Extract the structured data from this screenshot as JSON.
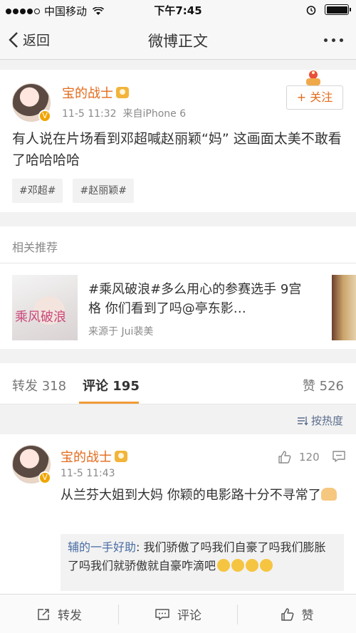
{
  "status_bar": {
    "carrier": "中国移动",
    "time": "下午7:45"
  },
  "nav": {
    "back_label": "返回",
    "title": "微博正文"
  },
  "post": {
    "username": "宝的战士",
    "date": "11-5 11:32",
    "source": "来自iPhone 6",
    "follow_label": "+ 关注",
    "text": "有人说在片场看到邓超喊赵丽颖“妈” 这画面太美不敢看了哈哈哈哈",
    "tags": [
      "#邓超#",
      "#赵丽颖#"
    ]
  },
  "related": {
    "heading": "相关推荐",
    "title": "#乘风破浪#多么用心的参赛选手 9宫格 你们看到了吗@亭东影…",
    "source": "来源于 Jui裴美",
    "thumb_signature": "乘风破浪"
  },
  "tabs": {
    "repost_label": "转发 318",
    "comments_label": "评论 195",
    "likes_label": "赞 526"
  },
  "sort": {
    "label": "按热度"
  },
  "comment": {
    "username": "宝的战士",
    "date": "11-5 11:43",
    "like_count": "120",
    "text": "从兰芬大姐到大妈 你颖的电影路十分不寻常了",
    "reply_name": "辅的一手好助",
    "reply_text": ": 我们骄傲了吗我们自豪了吗我们膨胀了吗我们就骄傲就自豪咋滴吧"
  },
  "bottom_bar": {
    "repost": "转发",
    "comment": "评论",
    "like": "赞"
  },
  "colors": {
    "accent_orange": "#e36b1d",
    "tab_underline": "#f19b38",
    "link_blue": "#4a6da4"
  }
}
